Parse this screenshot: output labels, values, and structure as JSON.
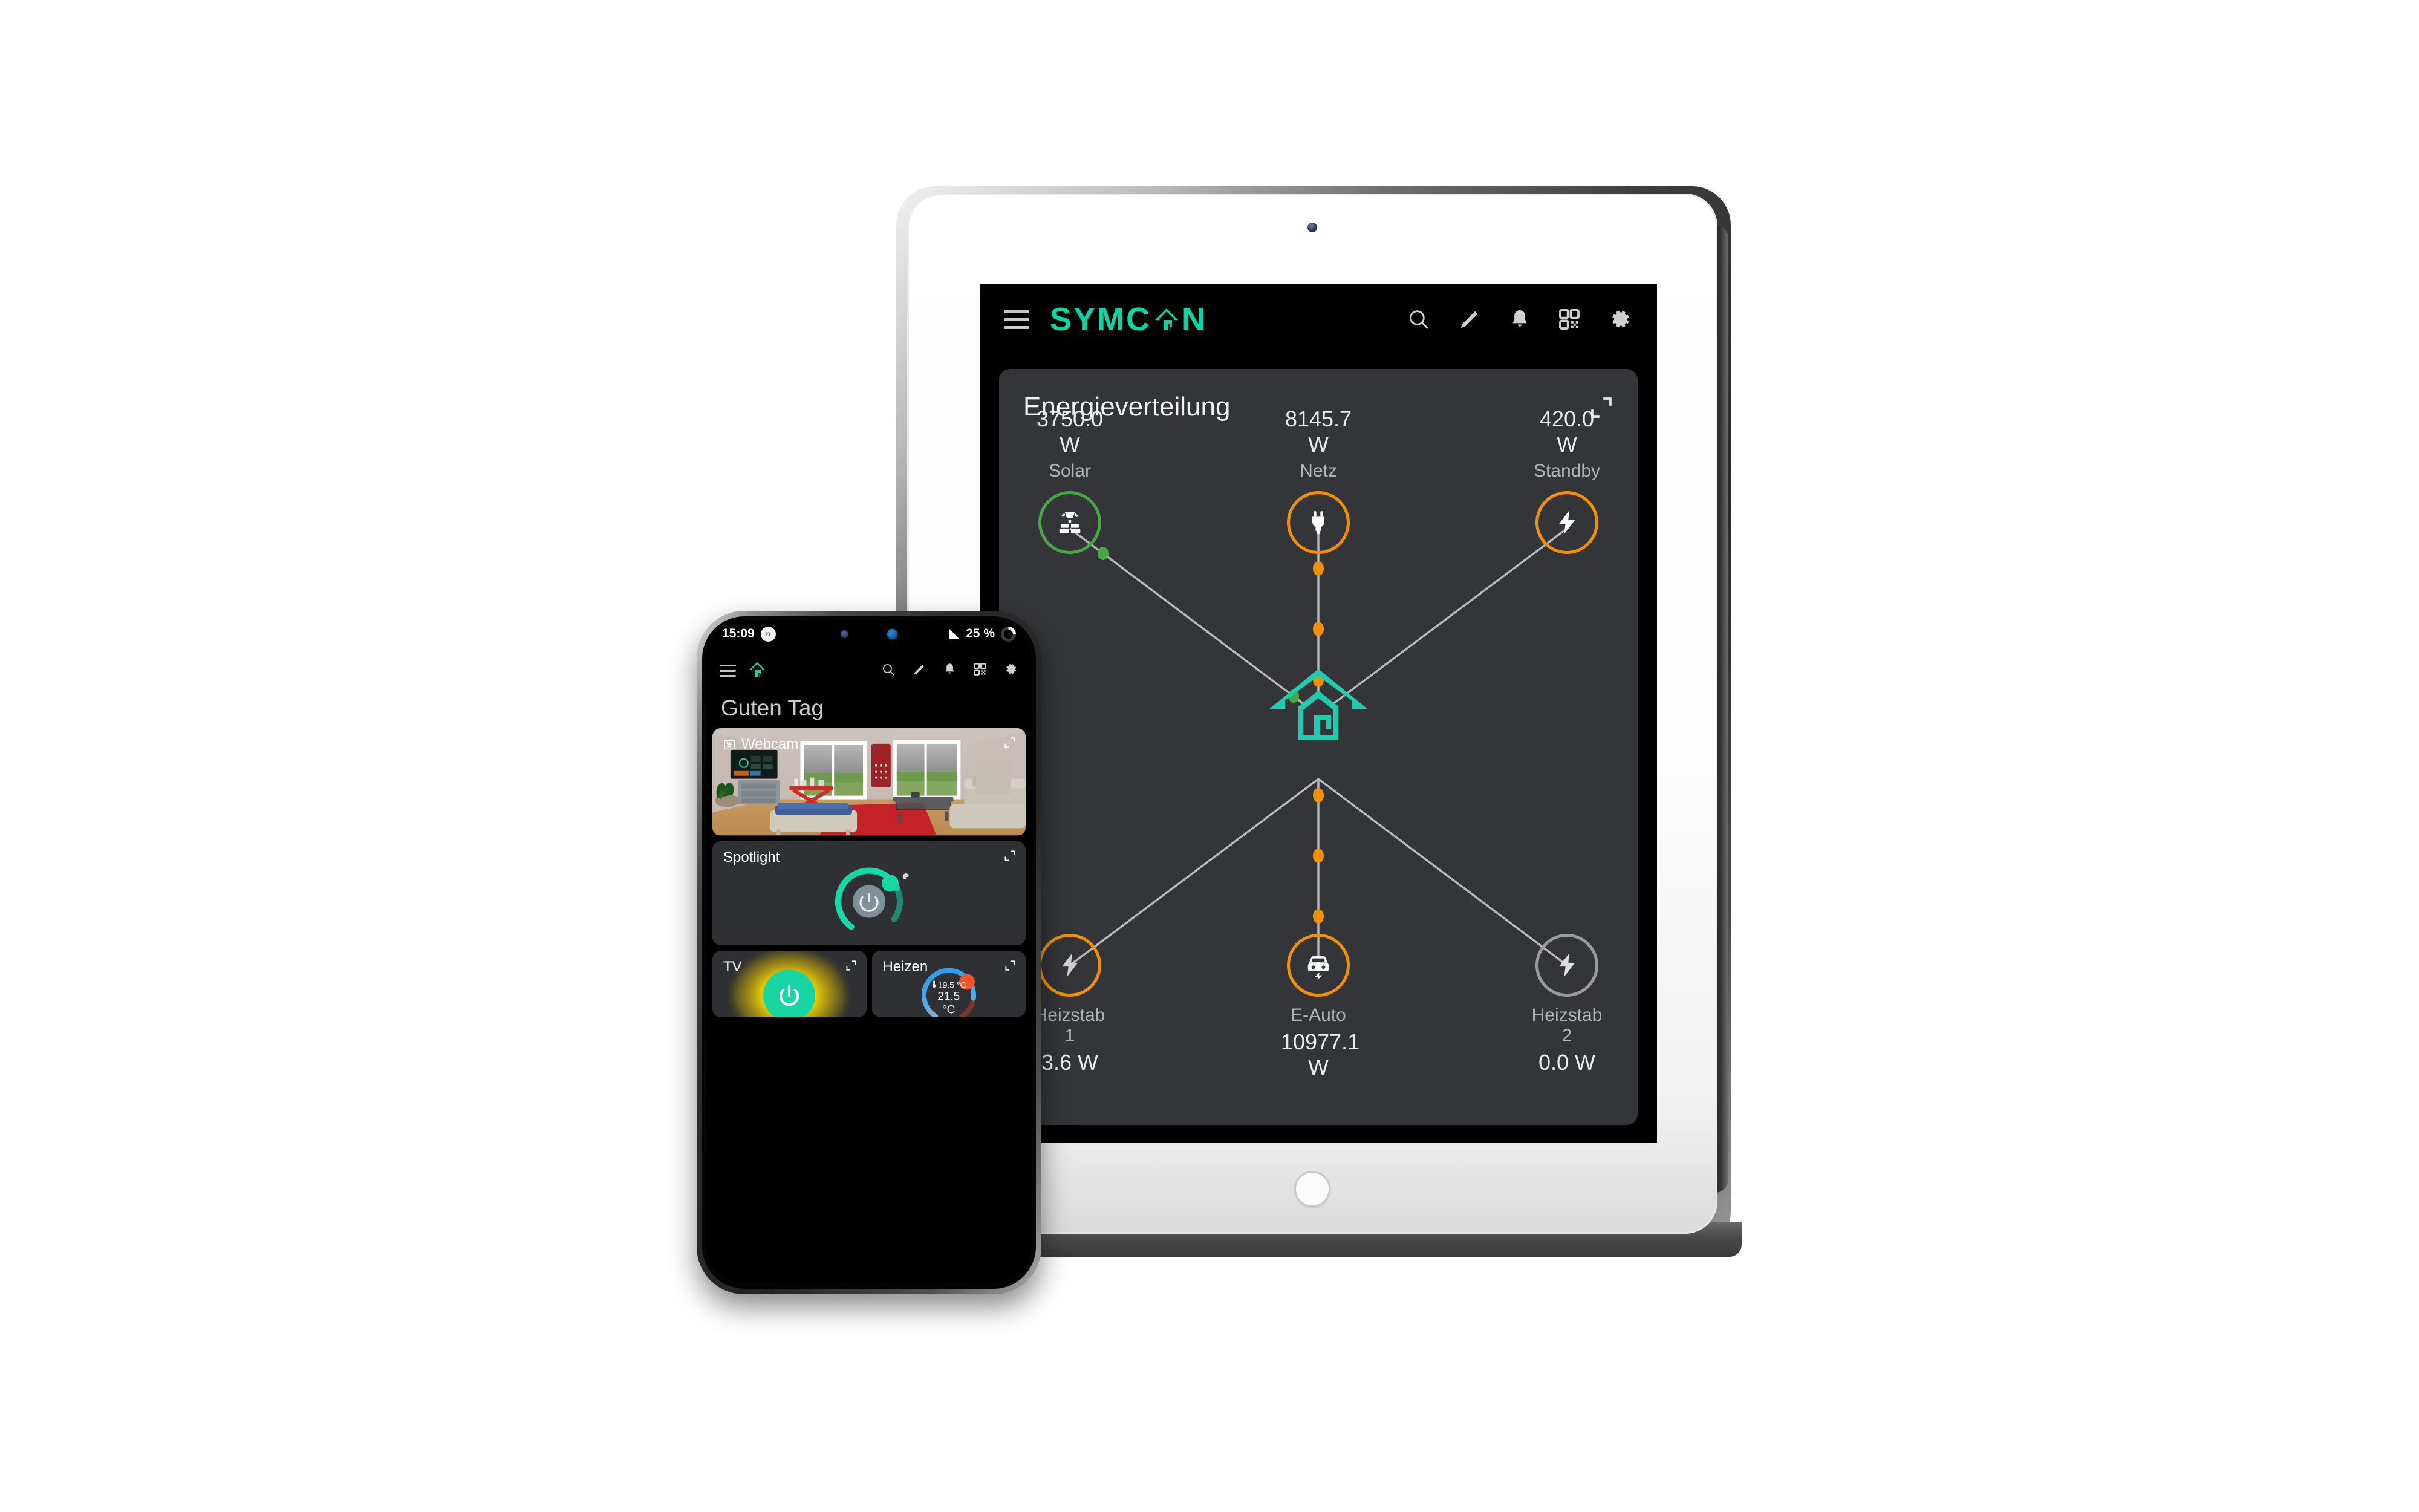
{
  "tablet": {
    "brand": "SYMC⌂N",
    "brand_text": "SYMC",
    "brand_text_end": "N",
    "icons": {
      "menu": "hamburger-menu-icon",
      "search": "search-icon",
      "edit": "pencil-icon",
      "bell": "bell-icon",
      "qr": "qr-code-icon",
      "settings": "gear-icon"
    },
    "energy_card": {
      "title": "Energieverteilung",
      "expand": "expand-icon",
      "nodes_top": [
        {
          "value": "3750.0 W",
          "label": "Solar",
          "icon": "solar-panel-icon",
          "ring": "#46a845"
        },
        {
          "value": "8145.7 W",
          "label": "Netz",
          "icon": "power-plug-icon",
          "ring": "#f29100"
        },
        {
          "value": "420.0 W",
          "label": "Standby",
          "icon": "lightning-bolt-icon",
          "ring": "#f29100"
        }
      ],
      "nodes_bottom": [
        {
          "label": "Heizstab 1",
          "value": "3.6 W",
          "icon": "lightning-bolt-icon",
          "ring": "#f29100"
        },
        {
          "label": "E-Auto",
          "value": "10977.1 W",
          "icon": "electric-car-icon",
          "ring": "#f29100"
        },
        {
          "label": "Heizstab 2",
          "value": "0.0 W",
          "icon": "lightning-bolt-icon",
          "ring": "#9a9a9a"
        }
      ],
      "center_icon": "home-house-icon"
    }
  },
  "phone": {
    "status": {
      "time": "15:09",
      "badge": "n",
      "battery": "25 %"
    },
    "header_icons": {
      "menu": "hamburger-menu-icon",
      "home": "home-house-icon",
      "search": "search-icon",
      "edit": "pencil-icon",
      "bell": "bell-icon",
      "qr": "qr-code-icon",
      "settings": "gear-icon"
    },
    "greeting": "Guten Tag",
    "cards": {
      "webcam": {
        "title": "Webcam",
        "icon": "camera-icon",
        "expand": "expand-icon"
      },
      "spotlight": {
        "title": "Spotlight",
        "expand": "expand-icon",
        "power": "power-icon",
        "palette": "palette-icon",
        "dim_percent": 78
      },
      "tv": {
        "title": "TV",
        "expand": "expand-icon",
        "power": "power-icon",
        "state": "on"
      },
      "heizen": {
        "title": "Heizen",
        "expand": "expand-icon",
        "current_temp": "19.5 °C",
        "target_temp": "21.5 °C",
        "thermometer": "thermometer-icon"
      }
    }
  },
  "colors": {
    "accent_teal": "#00d9a6",
    "orange": "#f29100",
    "green": "#46a845",
    "grey_line": "#b9b9b9",
    "card_bg": "#333538",
    "screen_bg": "#000000"
  },
  "chart_data": {
    "type": "diagram",
    "title": "Energieverteilung",
    "nodes": [
      {
        "id": "solar",
        "label": "Solar",
        "value": 3750.0,
        "unit": "W",
        "position": "top-left",
        "status": "producing",
        "color": "#46a845"
      },
      {
        "id": "netz",
        "label": "Netz",
        "value": 8145.7,
        "unit": "W",
        "position": "top-center",
        "status": "importing",
        "color": "#f29100"
      },
      {
        "id": "standby",
        "label": "Standby",
        "value": 420.0,
        "unit": "W",
        "position": "top-right",
        "status": "consuming",
        "color": "#f29100"
      },
      {
        "id": "house",
        "label": "Haus",
        "value": null,
        "unit": "",
        "position": "center",
        "status": "hub",
        "color": "#00d9a6"
      },
      {
        "id": "heizstab1",
        "label": "Heizstab 1",
        "value": 3.6,
        "unit": "W",
        "position": "bottom-left",
        "status": "consuming",
        "color": "#f29100"
      },
      {
        "id": "eauto",
        "label": "E-Auto",
        "value": 10977.1,
        "unit": "W",
        "position": "bottom-center",
        "status": "charging",
        "color": "#f29100"
      },
      {
        "id": "heizstab2",
        "label": "Heizstab 2",
        "value": 0.0,
        "unit": "W",
        "position": "bottom-right",
        "status": "idle",
        "color": "#9a9a9a"
      }
    ],
    "edges": [
      {
        "from": "solar",
        "to": "house",
        "flow_color": "#46a845"
      },
      {
        "from": "netz",
        "to": "house",
        "flow_color": "#f29100"
      },
      {
        "from": "standby",
        "to": "house",
        "flow_color": "#f29100"
      },
      {
        "from": "house",
        "to": "heizstab1",
        "flow_color": "#f29100"
      },
      {
        "from": "house",
        "to": "eauto",
        "flow_color": "#f29100"
      },
      {
        "from": "house",
        "to": "heizstab2",
        "flow_color": "#9a9a9a"
      }
    ]
  }
}
